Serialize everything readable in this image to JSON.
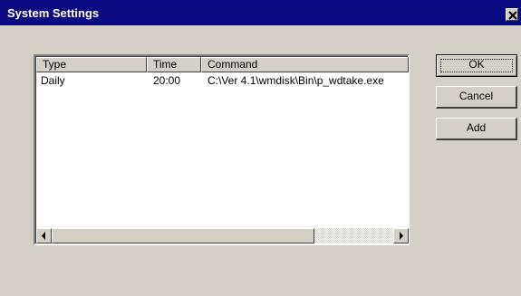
{
  "window": {
    "title": "System Settings"
  },
  "list": {
    "columns": [
      "Type",
      "Time",
      "Command"
    ],
    "rows": [
      {
        "type": "Daily",
        "time": "20:00",
        "command": "C:\\Ver 4.1\\wmdisk\\Bin\\p_wdtake.exe"
      }
    ]
  },
  "buttons": {
    "ok": "OK",
    "cancel": "Cancel",
    "add": "Add"
  },
  "icons": {
    "close": "close-icon",
    "scroll_left": "arrow-left-icon",
    "scroll_right": "arrow-right-icon"
  }
}
